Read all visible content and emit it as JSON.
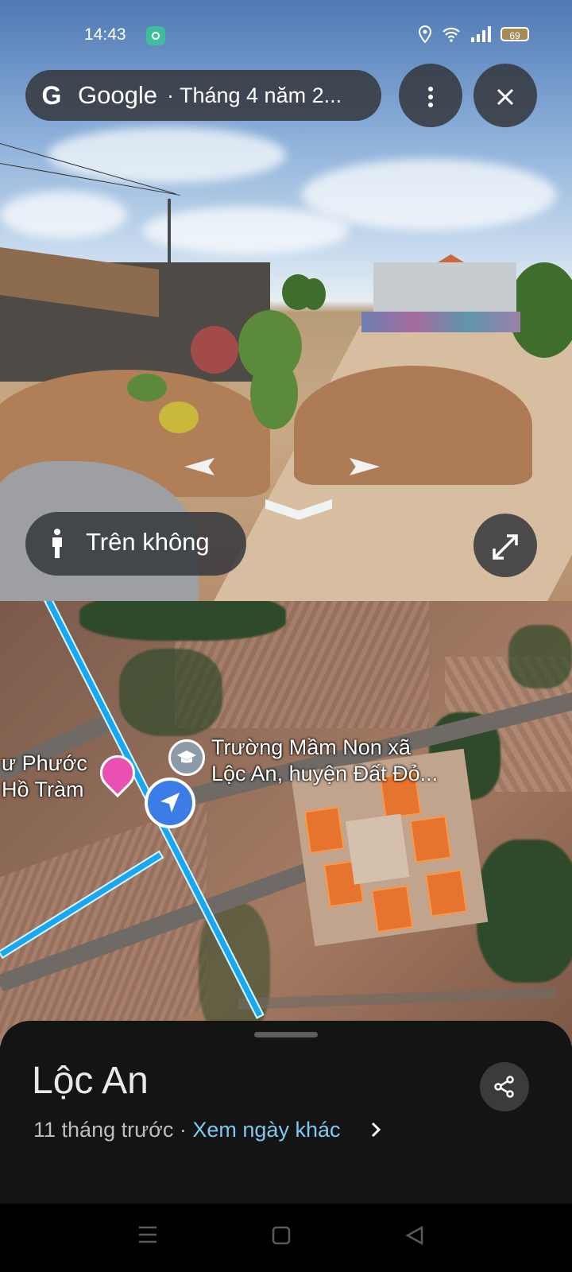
{
  "status_bar": {
    "time": "14:43",
    "battery": "69"
  },
  "streetview": {
    "brand": "Google",
    "date_label": "· Tháng 4 năm 2...",
    "aerial_label": "Trên không"
  },
  "map": {
    "poi_school": [
      "Trường Mầm Non xã",
      "Lộc An, huyện Đất Đỏ..."
    ],
    "poi_left": [
      "ư Phước",
      "Hồ Tràm"
    ]
  },
  "sheet": {
    "title": "Lộc An",
    "ago": "11 tháng trước · ",
    "other_dates": "Xem ngày khác"
  },
  "icons": [
    "location-pin-icon",
    "wifi-icon",
    "signal-icon",
    "battery-icon",
    "more-icon",
    "close-icon",
    "person-icon",
    "expand-icon",
    "school-icon",
    "pink-pin-icon",
    "share-icon",
    "menu-icon",
    "home-icon",
    "back-icon"
  ],
  "colors": {
    "route": "#16a8f0",
    "location": "#3b7ce6",
    "link": "#7fc8f0",
    "sheet_bg": "#141414"
  }
}
